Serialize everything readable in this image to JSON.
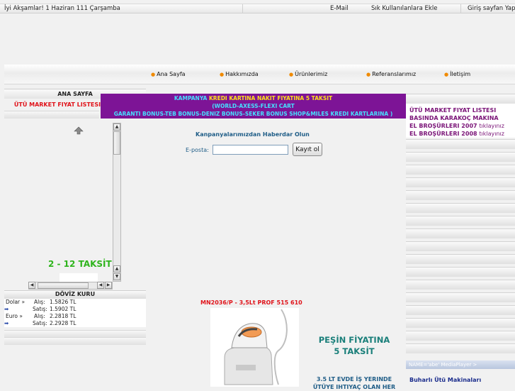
{
  "topbar": {
    "greeting": "İyi Akşamlar! 1 Haziran 111 Çarşamba",
    "email_link": "E-Mail",
    "favorites_link": "Sık Kullanılanlara Ekle",
    "homepage_link": "Giriş sayfan Yap"
  },
  "nav": {
    "items": [
      "Ana Sayfa",
      "Hakkımızda",
      "Ürünlerimiz",
      "Referanslarımız",
      "İletişim"
    ]
  },
  "left": {
    "home_header": "ANA SAYFA",
    "price_list_link": "ÜTÜ MARKET FIYAT LISTESI",
    "taksit_text": "2 - 12 TAKSİT",
    "doviz_header": "DÖVİZ KURU",
    "doviz": [
      {
        "currency": "Dolar »",
        "type": "Alış:",
        "value": "1.5826 TL"
      },
      {
        "currency": "",
        "type": "Satış:",
        "value": "1.5902 TL"
      },
      {
        "currency": "Euro »",
        "type": "Alış:",
        "value": "2.2818 TL"
      },
      {
        "currency": "",
        "type": "Satış:",
        "value": "2.2928 TL"
      }
    ]
  },
  "campaign": {
    "line1_a": "KAMPANYA",
    "line1_b": "KREDI KARTINA NAKIT FIYATINA  5 TAKSIT",
    "line2": "(WORLD-AXESS-FLEXI CART",
    "line3": "GARANTI BONUS-TEB BONUS-DENIZ BONUS-SEKER BONUS SHOP&MILES KREDI KARTLARINA )"
  },
  "newsletter": {
    "title": "Kanpanyalarımızdan Haberdar Olun",
    "email_label": "E-posta:",
    "email_value": "",
    "button": "Kayıt ol"
  },
  "product": {
    "title": "MN2036/P - 3,5Lt PROF  515 610",
    "pesin_line1": "PEŞİN FİYATINA",
    "pesin_line2": "5 TAKSİT",
    "promo_line1": "3.5 LT  EVDE İŞ YERINDE",
    "promo_line2": "ÜTÜYE IHTIYAÇ OLAN HER"
  },
  "right": {
    "price_list_1": "ÜTÜ MARKET FIYAT LISTESI",
    "price_list_2": "BASINDA KARAKOÇ MAKINA",
    "brochure_2007": "EL BROŞÜRLERI 2007",
    "brochure_2008": "EL BROŞÜRLERI 2008",
    "click_text": "tıklayınız",
    "media_bar": "NAME='abe' MediaPlayer >",
    "category": "Buharlı Ütü Makinaları"
  },
  "colors": {
    "campaign_bg": "#7d1496",
    "price_red": "#e0131a",
    "taksit_green": "#2fb41d",
    "link_blue": "#1f5d87"
  }
}
